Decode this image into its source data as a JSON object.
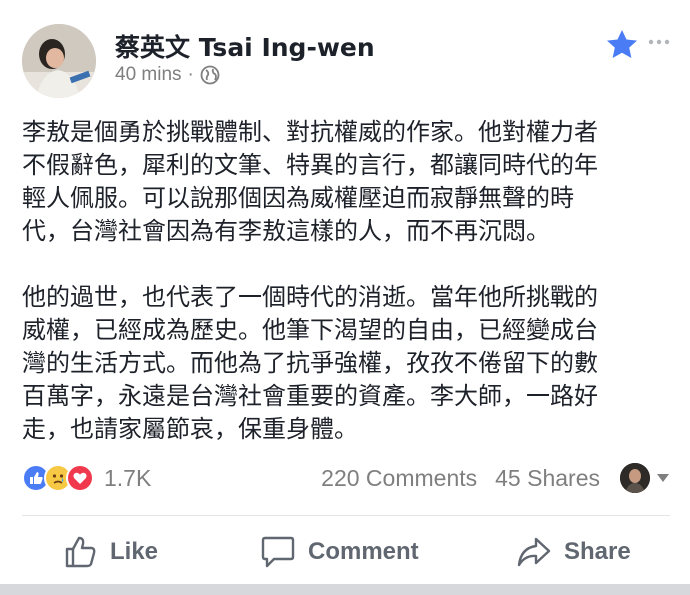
{
  "post": {
    "author": "蔡英文 Tsai Ing-wen",
    "time": "40 mins",
    "separator": "·",
    "paragraphs": [
      "李敖是個勇於挑戰體制、對抗權威的作家。他對權力者\n不假辭色，犀利的文筆、特異的言行，都讓同時代的年\n輕人佩服。可以說那個因為威權壓迫而寂靜無聲的時\n代，台灣社會因為有李敖這樣的人，而不再沉悶。",
      "他的過世，也代表了一個時代的消逝。當年他所挑戰的\n威權，已經成為歷史。他筆下渴望的自由，已經變成台\n灣的生活方式。而他為了抗爭強權，孜孜不倦留下的數\n百萬字，永遠是台灣社會重要的資產。李大師，一路好\n走，也請家屬節哀，保重身體。"
    ]
  },
  "icons": {
    "audience": "globe-icon",
    "favorite": "star-icon",
    "menu": "more-icon",
    "reactions": [
      "like-reaction-icon",
      "sad-reaction-icon",
      "love-reaction-icon"
    ]
  },
  "stats": {
    "reactions": "1.7K",
    "comments": "220 Comments",
    "shares": "45 Shares"
  },
  "actions": {
    "like": "Like",
    "comment": "Comment",
    "share": "Share"
  },
  "colors": {
    "favorite_star": "#4a7cf5",
    "like_reaction": "#4a7cf5",
    "sad_reaction": "#f7c843",
    "love_reaction": "#f1394e",
    "action_text": "#606770"
  }
}
